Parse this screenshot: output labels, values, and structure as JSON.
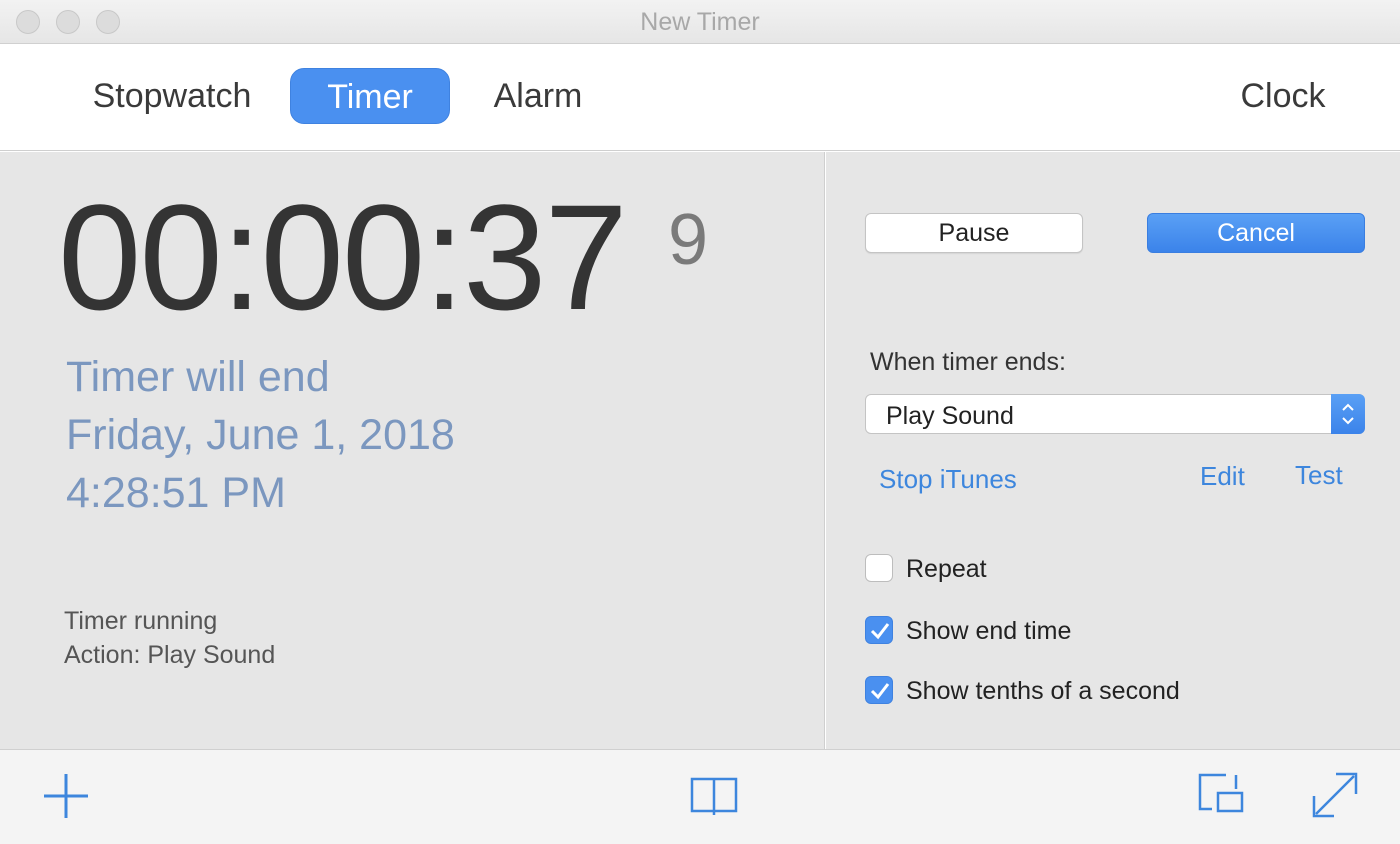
{
  "window": {
    "title": "New Timer"
  },
  "tabs": [
    {
      "label": "Stopwatch",
      "active": false
    },
    {
      "label": "Timer",
      "active": true
    },
    {
      "label": "Alarm",
      "active": false
    },
    {
      "label": "Clock",
      "active": false
    }
  ],
  "display": {
    "time": "00:00:37",
    "tenths": "9",
    "end_lines": [
      "Timer will end",
      "Friday, June 1, 2018",
      "4:28:51 PM"
    ],
    "status": "Timer running",
    "action": "Action: Play Sound"
  },
  "controls": {
    "pause_label": "Pause",
    "cancel_label": "Cancel",
    "when_ends_label": "When timer ends:",
    "action_select_value": "Play Sound",
    "stop_itunes_label": "Stop iTunes",
    "edit_label": "Edit",
    "test_label": "Test",
    "options": [
      {
        "label": "Repeat",
        "checked": false
      },
      {
        "label": "Show end time",
        "checked": true
      },
      {
        "label": "Show tenths of a second",
        "checked": true
      }
    ]
  },
  "toolbar": {
    "icons": [
      "plus-icon",
      "book-icon",
      "mini-window-icon",
      "expand-icon"
    ]
  },
  "colors": {
    "accent": "#4a90f0",
    "link": "#3d86dd",
    "end_text": "#7b97bf",
    "panel_bg": "#e6e6e6"
  }
}
